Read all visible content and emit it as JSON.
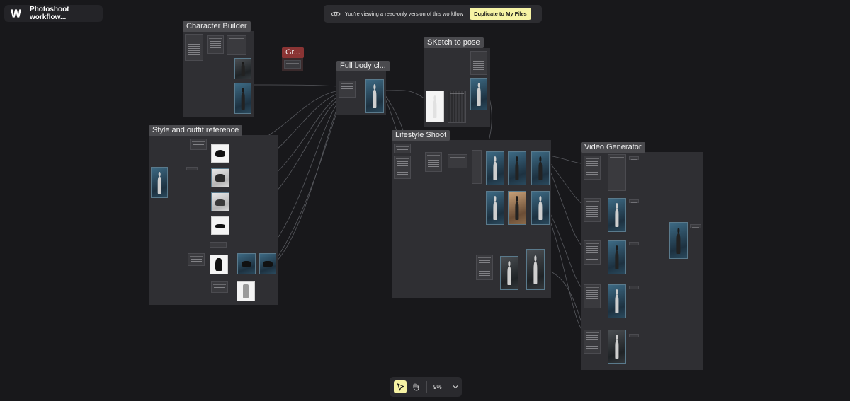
{
  "app": {
    "title": "Photoshoot workflow..."
  },
  "banner": {
    "text": "You're viewing a read-only version of this workflow",
    "duplicate_label": "Duplicate to My Files"
  },
  "groups": {
    "character_builder": "Character Builder",
    "gr": "Gr...",
    "full_body": "Full body cl...",
    "sketch_to_pose": "SKetch to pose",
    "style_outfit": "Style and outfit reference",
    "lifestyle_shoot": "Lifestyle Shoot",
    "video_generator": "Video Generator"
  },
  "toolbar": {
    "zoom": "9%"
  },
  "colors": {
    "accent": "#f6f3a4",
    "canvas": "#18181b",
    "group": "#2f2f33",
    "red_group": "#8a3434"
  },
  "icons": [
    "app-logo-icon",
    "eye-icon",
    "pointer-icon",
    "hand-icon",
    "chevron-down-icon"
  ]
}
